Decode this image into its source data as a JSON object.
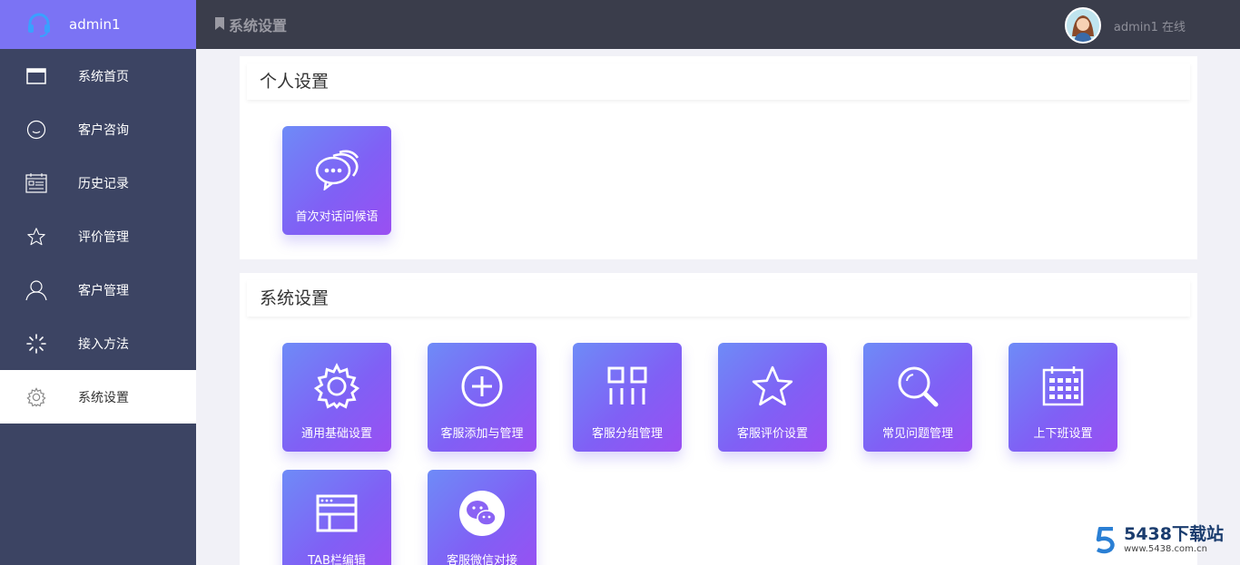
{
  "brand": {
    "name": "admin1",
    "icon": "headset-icon"
  },
  "sidebar": {
    "items": [
      {
        "label": "系统首页",
        "icon": "window-icon"
      },
      {
        "label": "客户咨询",
        "icon": "smile-icon"
      },
      {
        "label": "历史记录",
        "icon": "calendar-list-icon"
      },
      {
        "label": "评价管理",
        "icon": "star-icon"
      },
      {
        "label": "客户管理",
        "icon": "user-icon"
      },
      {
        "label": "接入方法",
        "icon": "spinner-icon"
      },
      {
        "label": "系统设置",
        "icon": "gear-icon",
        "active": true
      }
    ]
  },
  "header": {
    "title": "系统设置",
    "user_status": "admin1 在线"
  },
  "personal": {
    "title": "个人设置",
    "tiles": [
      {
        "label": "首次对话问候语",
        "icon": "chat-bubbles-icon"
      }
    ]
  },
  "system": {
    "title": "系统设置",
    "tiles": [
      {
        "label": "通用基础设置",
        "icon": "gear-icon"
      },
      {
        "label": "客服添加与管理",
        "icon": "plus-circle-icon"
      },
      {
        "label": "客服分组管理",
        "icon": "group-grid-icon"
      },
      {
        "label": "客服评价设置",
        "icon": "star-icon"
      },
      {
        "label": "常见问题管理",
        "icon": "search-icon"
      },
      {
        "label": "上下班设置",
        "icon": "calendar-icon"
      },
      {
        "label": "TAB栏编辑",
        "icon": "browser-window-icon"
      },
      {
        "label": "客服微信对接",
        "icon": "wechat-icon"
      }
    ]
  },
  "watermark": {
    "title": "5438下载站",
    "url": "www.5438.com.cn"
  },
  "colors": {
    "sidebar": "#3c4463",
    "brand": "#7b73f4",
    "header": "#3a3d4b",
    "tile_start": "#6e8bf7",
    "tile_end": "#9a4ff2"
  }
}
